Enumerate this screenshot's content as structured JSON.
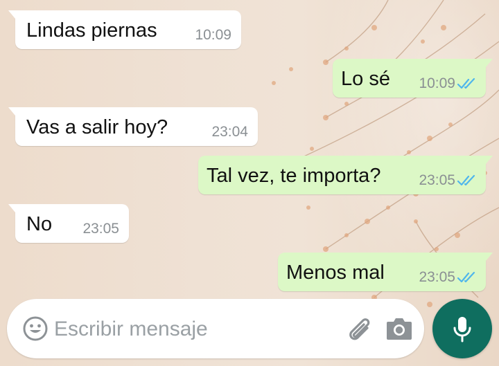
{
  "messages": [
    {
      "direction": "in",
      "text": "Lindas piernas",
      "time": "10:09"
    },
    {
      "direction": "out",
      "text": "Lo sé",
      "time": "10:09",
      "status": "read"
    },
    {
      "direction": "in",
      "text": "Vas a salir hoy?",
      "time": "23:04"
    },
    {
      "direction": "out",
      "text": "Tal vez, te importa?",
      "time": "23:05",
      "status": "read"
    },
    {
      "direction": "in",
      "text": "No",
      "time": "23:05"
    },
    {
      "direction": "out",
      "text": "Menos mal",
      "time": "23:05",
      "status": "read"
    }
  ],
  "composer": {
    "placeholder": "Escribir mensaje",
    "value": "",
    "icons": [
      "emoji-icon",
      "paperclip-icon",
      "camera-icon"
    ]
  },
  "mic_button": {
    "icon": "microphone-icon"
  },
  "colors": {
    "incoming_bubble": "#ffffff",
    "outgoing_bubble": "#dcf8c6",
    "read_ticks": "#4fb6ec",
    "mic_button": "#0f6e5f",
    "timestamp": "#8a8f93"
  }
}
